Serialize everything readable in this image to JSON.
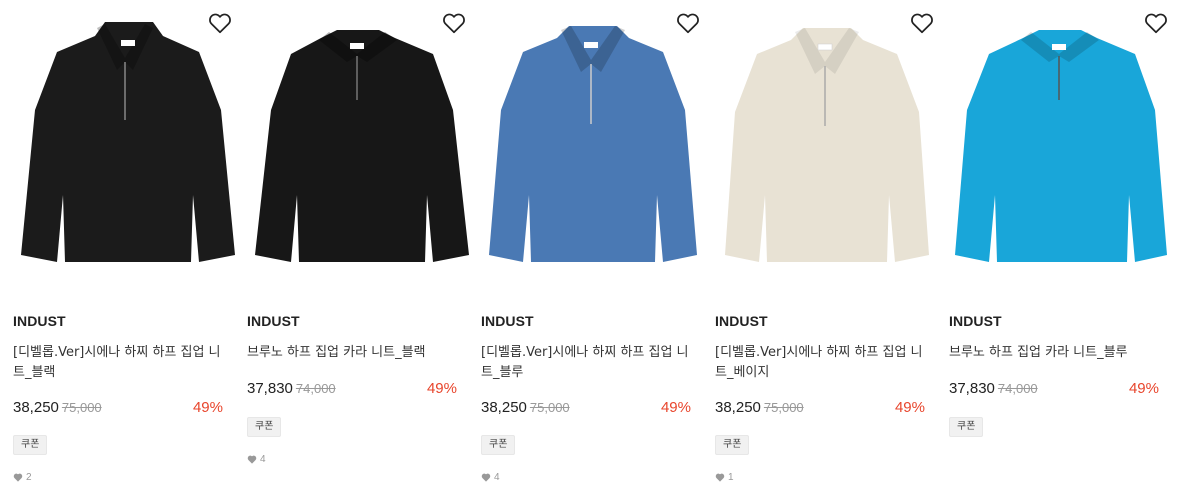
{
  "products": [
    {
      "brand": "INDUST",
      "name": "[디벨롭.Ver]시에나 하찌 하프 집업 니트_블랙",
      "price": "38,250",
      "original_price": "75,000",
      "discount": "49%",
      "coupon": "쿠폰",
      "likes": "2",
      "color": "#1b1b1b",
      "icon": "heart-outline-icon"
    },
    {
      "brand": "INDUST",
      "name": "브루노 하프 집업 카라 니트_블랙",
      "price": "37,830",
      "original_price": "74,000",
      "discount": "49%",
      "coupon": "쿠폰",
      "likes": "4",
      "color": "#171717",
      "icon": "heart-outline-icon"
    },
    {
      "brand": "INDUST",
      "name": "[디벨롭.Ver]시에나 하찌 하프 집업 니트_블루",
      "price": "38,250",
      "original_price": "75,000",
      "discount": "49%",
      "coupon": "쿠폰",
      "likes": "4",
      "color": "#4a79b4",
      "icon": "heart-outline-icon"
    },
    {
      "brand": "INDUST",
      "name": "[디벨롭.Ver]시에나 하찌 하프 집업 니트_베이지",
      "price": "38,250",
      "original_price": "75,000",
      "discount": "49%",
      "coupon": "쿠폰",
      "likes": "1",
      "color": "#e8e2d4",
      "icon": "heart-outline-icon"
    },
    {
      "brand": "INDUST",
      "name": "브루노 하프 집업 카라 니트_블루",
      "price": "37,830",
      "original_price": "74,000",
      "discount": "49%",
      "coupon": "쿠폰",
      "likes": "",
      "color": "#19a6d9",
      "icon": "heart-outline-icon"
    }
  ],
  "colors": {
    "discount": "#e8452c",
    "original_price": "#999999",
    "coupon_bg": "#f1f1f1"
  }
}
